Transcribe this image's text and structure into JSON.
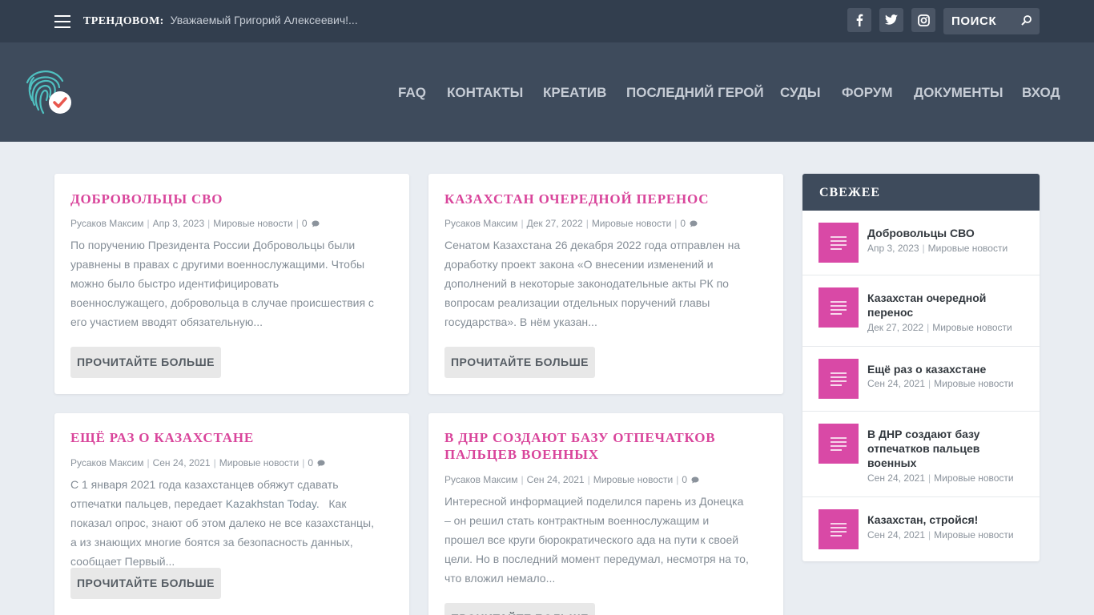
{
  "topbar": {
    "trending_label": "ТРЕНДОВОМ:",
    "trending_text": "Уважаемый Григорий Алексеевич!...",
    "search_placeholder": "ПОИСК"
  },
  "nav": {
    "items": [
      "FAQ",
      "КОНТАКТЫ",
      "КРЕАТИВ",
      "ПОСЛЕДНИЙ ГЕРОЙ",
      "СУДЫ",
      "ФОРУМ",
      "ДОКУМЕНТЫ",
      "ВХОД"
    ]
  },
  "posts": [
    {
      "title": "ДОБРОВОЛЬЦЫ СВО",
      "author": "Русаков Максим",
      "date": "Апр 3, 2023",
      "category": "Мировые новости",
      "comments": "0",
      "excerpt": "По поручению Президента России Добровольцы были уравнены в правах с другими военнослужащими. Чтобы можно было быстро идентифицировать военнослужащего, добровольца в случае происшествия с его участием вводят обязательную...",
      "more": "ПРОЧИТАЙТЕ БОЛЬШЕ"
    },
    {
      "title": "КАЗАХСТАН ОЧЕРЕДНОЙ ПЕРЕНОС",
      "author": "Русаков Максим",
      "date": "Дек 27, 2022",
      "category": "Мировые новости",
      "comments": "0",
      "excerpt": "Сенатом Казахстана 26 декабря 2022 года отправлен на доработку проект закона «О внесении изменений и дополнений в некоторые законодательные акты РК по вопросам реализации отдельных поручений главы государства». В нём указан...",
      "more": "ПРОЧИТАЙТЕ БОЛЬШЕ"
    },
    {
      "title": "ЕЩЁ РАЗ О КАЗАХСТАНЕ",
      "author": "Русаков Максим",
      "date": "Сен 24, 2021",
      "category": "Мировые новости",
      "comments": "0",
      "excerpt_a": "С 1 января 2021 года казахстанцев обяжут сдавать отпечатки пальцев, передает",
      "excerpt_link": "Kazakhstan Today.",
      "excerpt_b": "Как показал опрос, знают об этом далеко не все казахстанцы, а из знающих многие боятся за безопасность данных, сообщает Первый...",
      "more": "ПРОЧИТАЙТЕ БОЛЬШЕ"
    },
    {
      "title": "В ДНР СОЗДАЮТ БАЗУ ОТПЕЧАТКОВ ПАЛЬЦЕВ ВОЕННЫХ",
      "author": "Русаков Максим",
      "date": "Сен 24, 2021",
      "category": "Мировые новости",
      "comments": "0",
      "excerpt": "Интересной информацией поделился парень из Донецка – он решил стать контрактным военнослужащим и прошел все круги бюрократического ада на пути к своей цели. Но в последний момент передумал, несмотря на то, что вложил немало...",
      "more": "ПРОЧИТАЙТЕ БОЛЬШЕ"
    }
  ],
  "sidebar": {
    "title": "СВЕЖЕЕ",
    "items": [
      {
        "title": "Добровольцы СВО",
        "date": "Апр 3, 2023",
        "category": "Мировые новости"
      },
      {
        "title": "Казахстан очередной перенос",
        "date": "Дек 27, 2022",
        "category": "Мировые новости"
      },
      {
        "title": "Ещё раз о казахстане",
        "date": "Сен 24, 2021",
        "category": "Мировые новости"
      },
      {
        "title": "В ДНР создают базу отпечатков пальцев военных",
        "date": "Сен 24, 2021",
        "category": "Мировые новости"
      },
      {
        "title": "Казахстан, стройся!",
        "date": "Сен 24, 2021",
        "category": "Мировые новости"
      }
    ]
  },
  "colors": {
    "accent": "#d9459b",
    "topbar": "#323e4e",
    "header": "#3e4b5c",
    "background": "#e9edf2"
  }
}
